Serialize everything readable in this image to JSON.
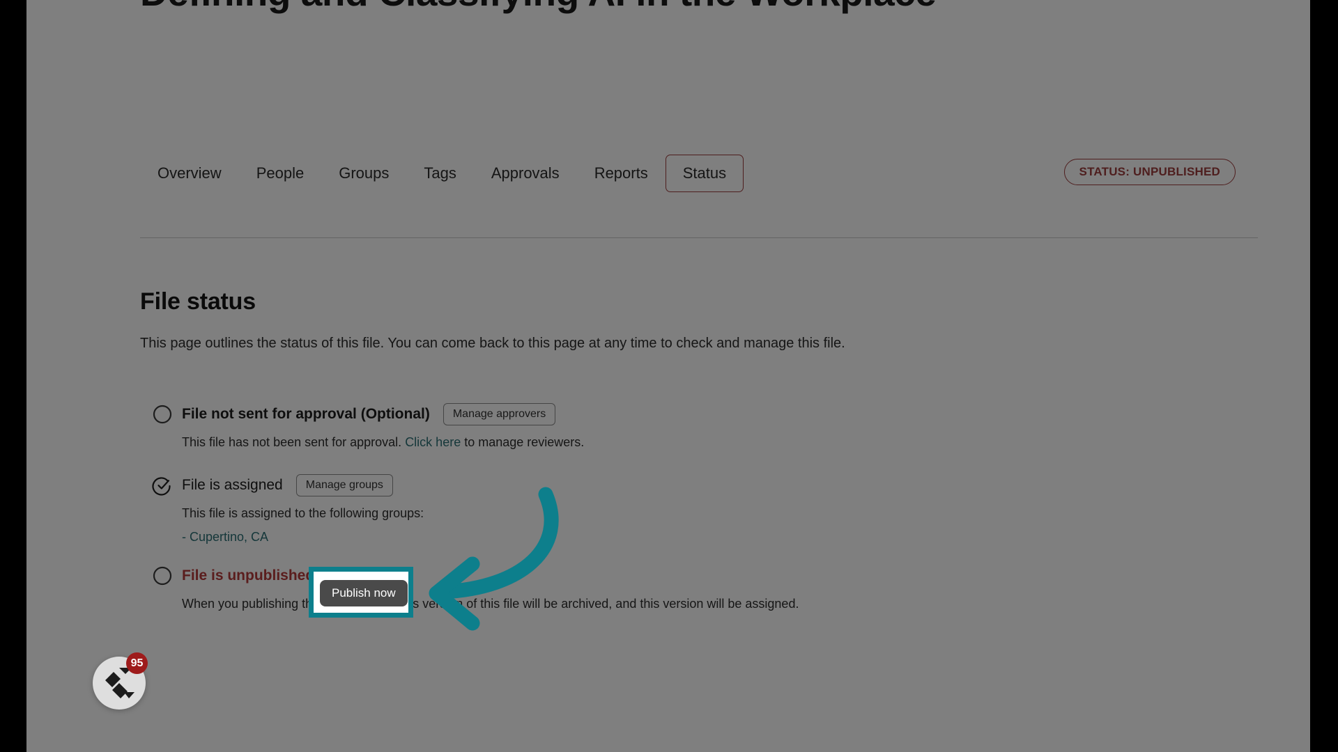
{
  "document": {
    "title": "Defining and Classifying AI in the Workplace"
  },
  "tabs": [
    {
      "label": "Overview",
      "active": false
    },
    {
      "label": "People",
      "active": false
    },
    {
      "label": "Groups",
      "active": false
    },
    {
      "label": "Tags",
      "active": false
    },
    {
      "label": "Approvals",
      "active": false
    },
    {
      "label": "Reports",
      "active": false
    },
    {
      "label": "Status",
      "active": true
    }
  ],
  "status_badge": {
    "label": "STATUS: UNPUBLISHED",
    "color": "#9d3c3c"
  },
  "section": {
    "heading": "File status",
    "description": "This page outlines the status of this file. You can come back to this page at any time to check and manage this file."
  },
  "status_rows": [
    {
      "icon": "empty-circle-icon",
      "title": "File not sent for approval (Optional)",
      "button": "Manage approvers",
      "body_before": "This file has not been sent for approval. ",
      "body_link": "Click here",
      "body_after": " to manage reviewers.",
      "state": "pending"
    },
    {
      "icon": "check-circle-icon",
      "title": "File is assigned",
      "button": "Manage groups",
      "body_before": "This file is assigned to the following groups:",
      "group": "- Cupertino, CA",
      "state": "complete"
    },
    {
      "icon": "empty-circle-icon",
      "title": "File is unpublished !",
      "body_before": "When you publishing this file, any previous version of this file will be archived, and this version will be assigned.",
      "state": "danger"
    }
  ],
  "annotation": {
    "button_label": "Publish now",
    "highlight_color": "#0d7f8c",
    "arrow_color": "#0d7f8c"
  },
  "widget": {
    "badge_count": "95",
    "logo": "c-logo-icon"
  },
  "colors": {
    "danger": "#b43a3a",
    "link": "#2a6f74",
    "teal_accent": "#0d7f8c",
    "badge_red": "#9e1b1b"
  }
}
